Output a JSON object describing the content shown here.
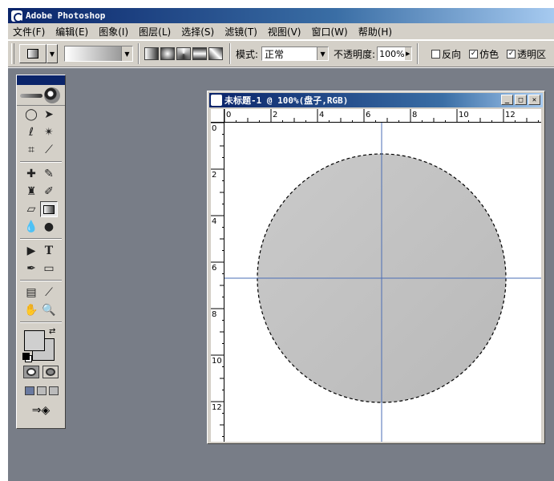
{
  "app": {
    "title": "Adobe Photoshop"
  },
  "menu": [
    "文件(F)",
    "编辑(E)",
    "图象(I)",
    "图层(L)",
    "选择(S)",
    "滤镜(T)",
    "视图(V)",
    "窗口(W)",
    "帮助(H)"
  ],
  "options": {
    "mode_label": "模式:",
    "mode_value": "正常",
    "opacity_label": "不透明度:",
    "opacity_value": "100%",
    "checkboxes": [
      {
        "label": "反向",
        "checked": false
      },
      {
        "label": "仿色",
        "checked": true
      },
      {
        "label": "透明区",
        "checked": true
      }
    ]
  },
  "document": {
    "title": "未标题-1 @ 100%(盘子,RGB)",
    "ruler_h_labels": [
      "0",
      "2",
      "4",
      "6",
      "8",
      "10",
      "12"
    ],
    "ruler_v_labels": [
      "0",
      "2",
      "4",
      "6",
      "8",
      "10",
      "12"
    ],
    "fill_color": "#c2c2c2",
    "guide_color": "#4a6db5"
  },
  "colors": {
    "foreground": "#cfcfcf",
    "background": "#c8c8c8"
  }
}
